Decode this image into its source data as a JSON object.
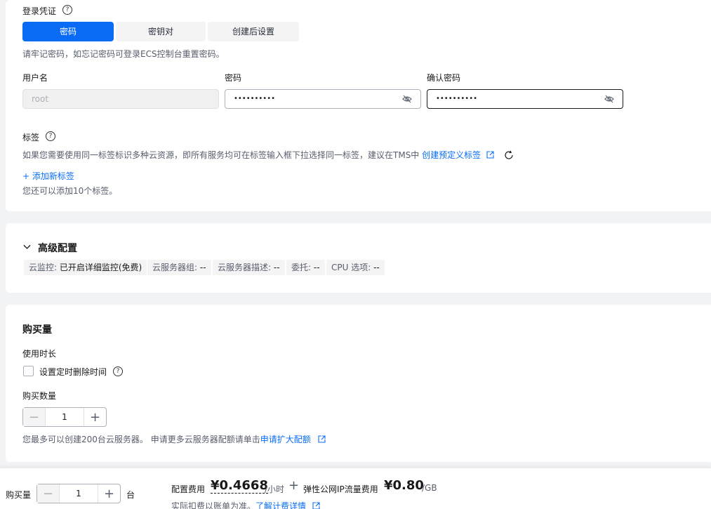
{
  "login": {
    "title": "登录凭证",
    "tabs": [
      {
        "label": "密码",
        "active": true
      },
      {
        "label": "密钥对",
        "active": false
      },
      {
        "label": "创建后设置",
        "active": false
      }
    ],
    "hint": "请牢记密码，如忘记密码可登录ECS控制台重置密码。",
    "username_label": "用户名",
    "username_value": "root",
    "password_label": "密码",
    "password_value": "••••••••••",
    "confirm_label": "确认密码",
    "confirm_value": "••••••••••"
  },
  "tags": {
    "title": "标签",
    "hint": "如果您需要使用同一标签标识多种云资源，即所有服务均可在标签输入框下拉选择同一标签，建议在TMS中",
    "create_link": "创建预定义标签",
    "add_link": "+ 添加新标签",
    "remaining": "您还可以添加10个标签。"
  },
  "advanced": {
    "title": "高级配置",
    "chips": [
      {
        "key": "云监控: ",
        "value": "已开启详细监控(免费)"
      },
      {
        "key": "云服务器组: ",
        "value": "--"
      },
      {
        "key": "云服务器描述: ",
        "value": "--"
      },
      {
        "key": "委托: ",
        "value": "--"
      },
      {
        "key": "CPU 选项: ",
        "value": "--"
      }
    ]
  },
  "purchase": {
    "title": "购买量",
    "duration_label": "使用时长",
    "schedule_delete_label": "设置定时删除时间",
    "quantity_label": "购买数量",
    "quantity_value": "1",
    "limit_hint": "您最多可以创建200台云服务器。 申请更多云服务器配额请单击",
    "quota_link": "申请扩大配额"
  },
  "footer": {
    "qty_label": "购买量",
    "qty_value": "1",
    "qty_unit": "台",
    "config_fee_label": "配置费用",
    "config_fee_value": "¥0.4668",
    "config_fee_unit": "/小时",
    "plus": "+",
    "eip_label": "弹性公网IP流量费用",
    "eip_value": "¥0.80",
    "eip_unit": "/GB",
    "note": "实际扣费以账单为准。",
    "detail_link": "了解计费详情"
  },
  "colors": {
    "accent": "#0a6cf5",
    "background": "#f2f3f5"
  }
}
